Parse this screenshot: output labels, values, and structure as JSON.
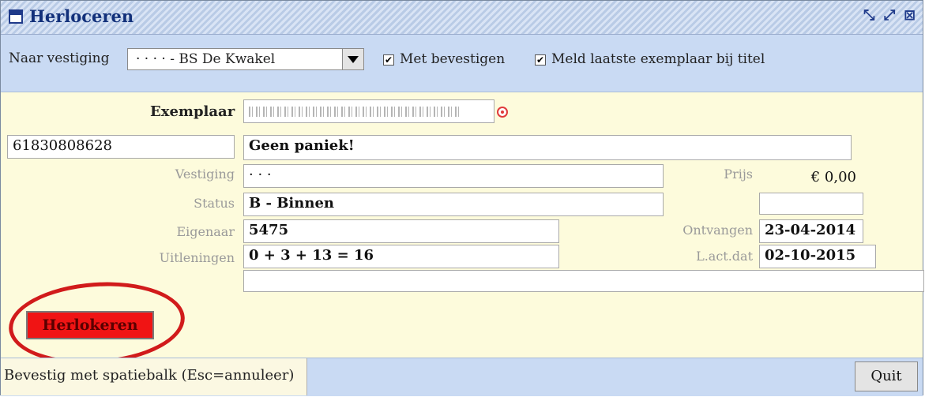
{
  "window": {
    "title": "Herloceren",
    "controls": {
      "restore": "⤡",
      "max": "⤢",
      "close": "⊠"
    }
  },
  "toolbar": {
    "branch_label": "Naar vestiging",
    "branch_value": "· · · · - BS De Kwakel",
    "confirm_label": "Met bevestigen",
    "confirm_checked": "✔",
    "last_copy_label": "Meld laatste exemplaar bij titel",
    "last_copy_checked": "✔"
  },
  "form": {
    "exemplaar_label": "Exemplaar",
    "exemplaar_number": "61830808628",
    "title": "Geen paniek!",
    "vestiging_label": "Vestiging",
    "vestiging_value": "· · ·",
    "status_label": "Status",
    "status_value": "B - Binnen",
    "eigenaar_label": "Eigenaar",
    "eigenaar_value": "5475",
    "uitleningen_label": "Uitleningen",
    "uitleningen_value": "0 + 3 + 13 = 16",
    "prijs_label": "Prijs",
    "prijs_value": "€ 0,00",
    "ontvangen_label": "Ontvangen",
    "ontvangen_value": "23-04-2014",
    "lactdat_label": "L.act.dat",
    "lactdat_value": "02-10-2015",
    "extra_value": ""
  },
  "actions": {
    "herlokeren_label": "Herlokeren",
    "quit_label": "Quit"
  },
  "statusbar": {
    "text": "Bevestig met spatiebalk (Esc=annuleer)"
  },
  "colors": {
    "highlight_button": "#f01414",
    "annotation_ring": "#d11b1b",
    "body_bg": "#fdfbdc",
    "toolbar_bg": "#c9daf3"
  }
}
